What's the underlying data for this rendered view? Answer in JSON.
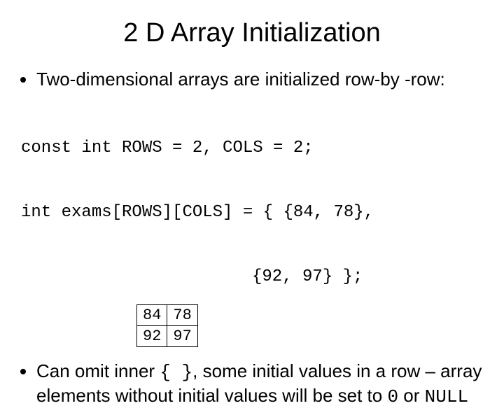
{
  "title": "2 D Array Initialization",
  "bullet1": "Two-dimensional arrays are initialized row-by -row:",
  "code": {
    "l1": "const int ROWS = 2, COLS = 2;",
    "l2": "int exams[ROWS][COLS] = { {84, 78},",
    "l3": "{92, 97} };"
  },
  "table": {
    "r0c0": "84",
    "r0c1": "78",
    "r1c0": "92",
    "r1c1": "97"
  },
  "bullet2": {
    "p1": "Can omit inner ",
    "brace": "{ }",
    "p2": ", some initial values in a row –  array elements without initial values will be set to ",
    "zero": "0",
    "p3": " or ",
    "null": "NULL"
  }
}
